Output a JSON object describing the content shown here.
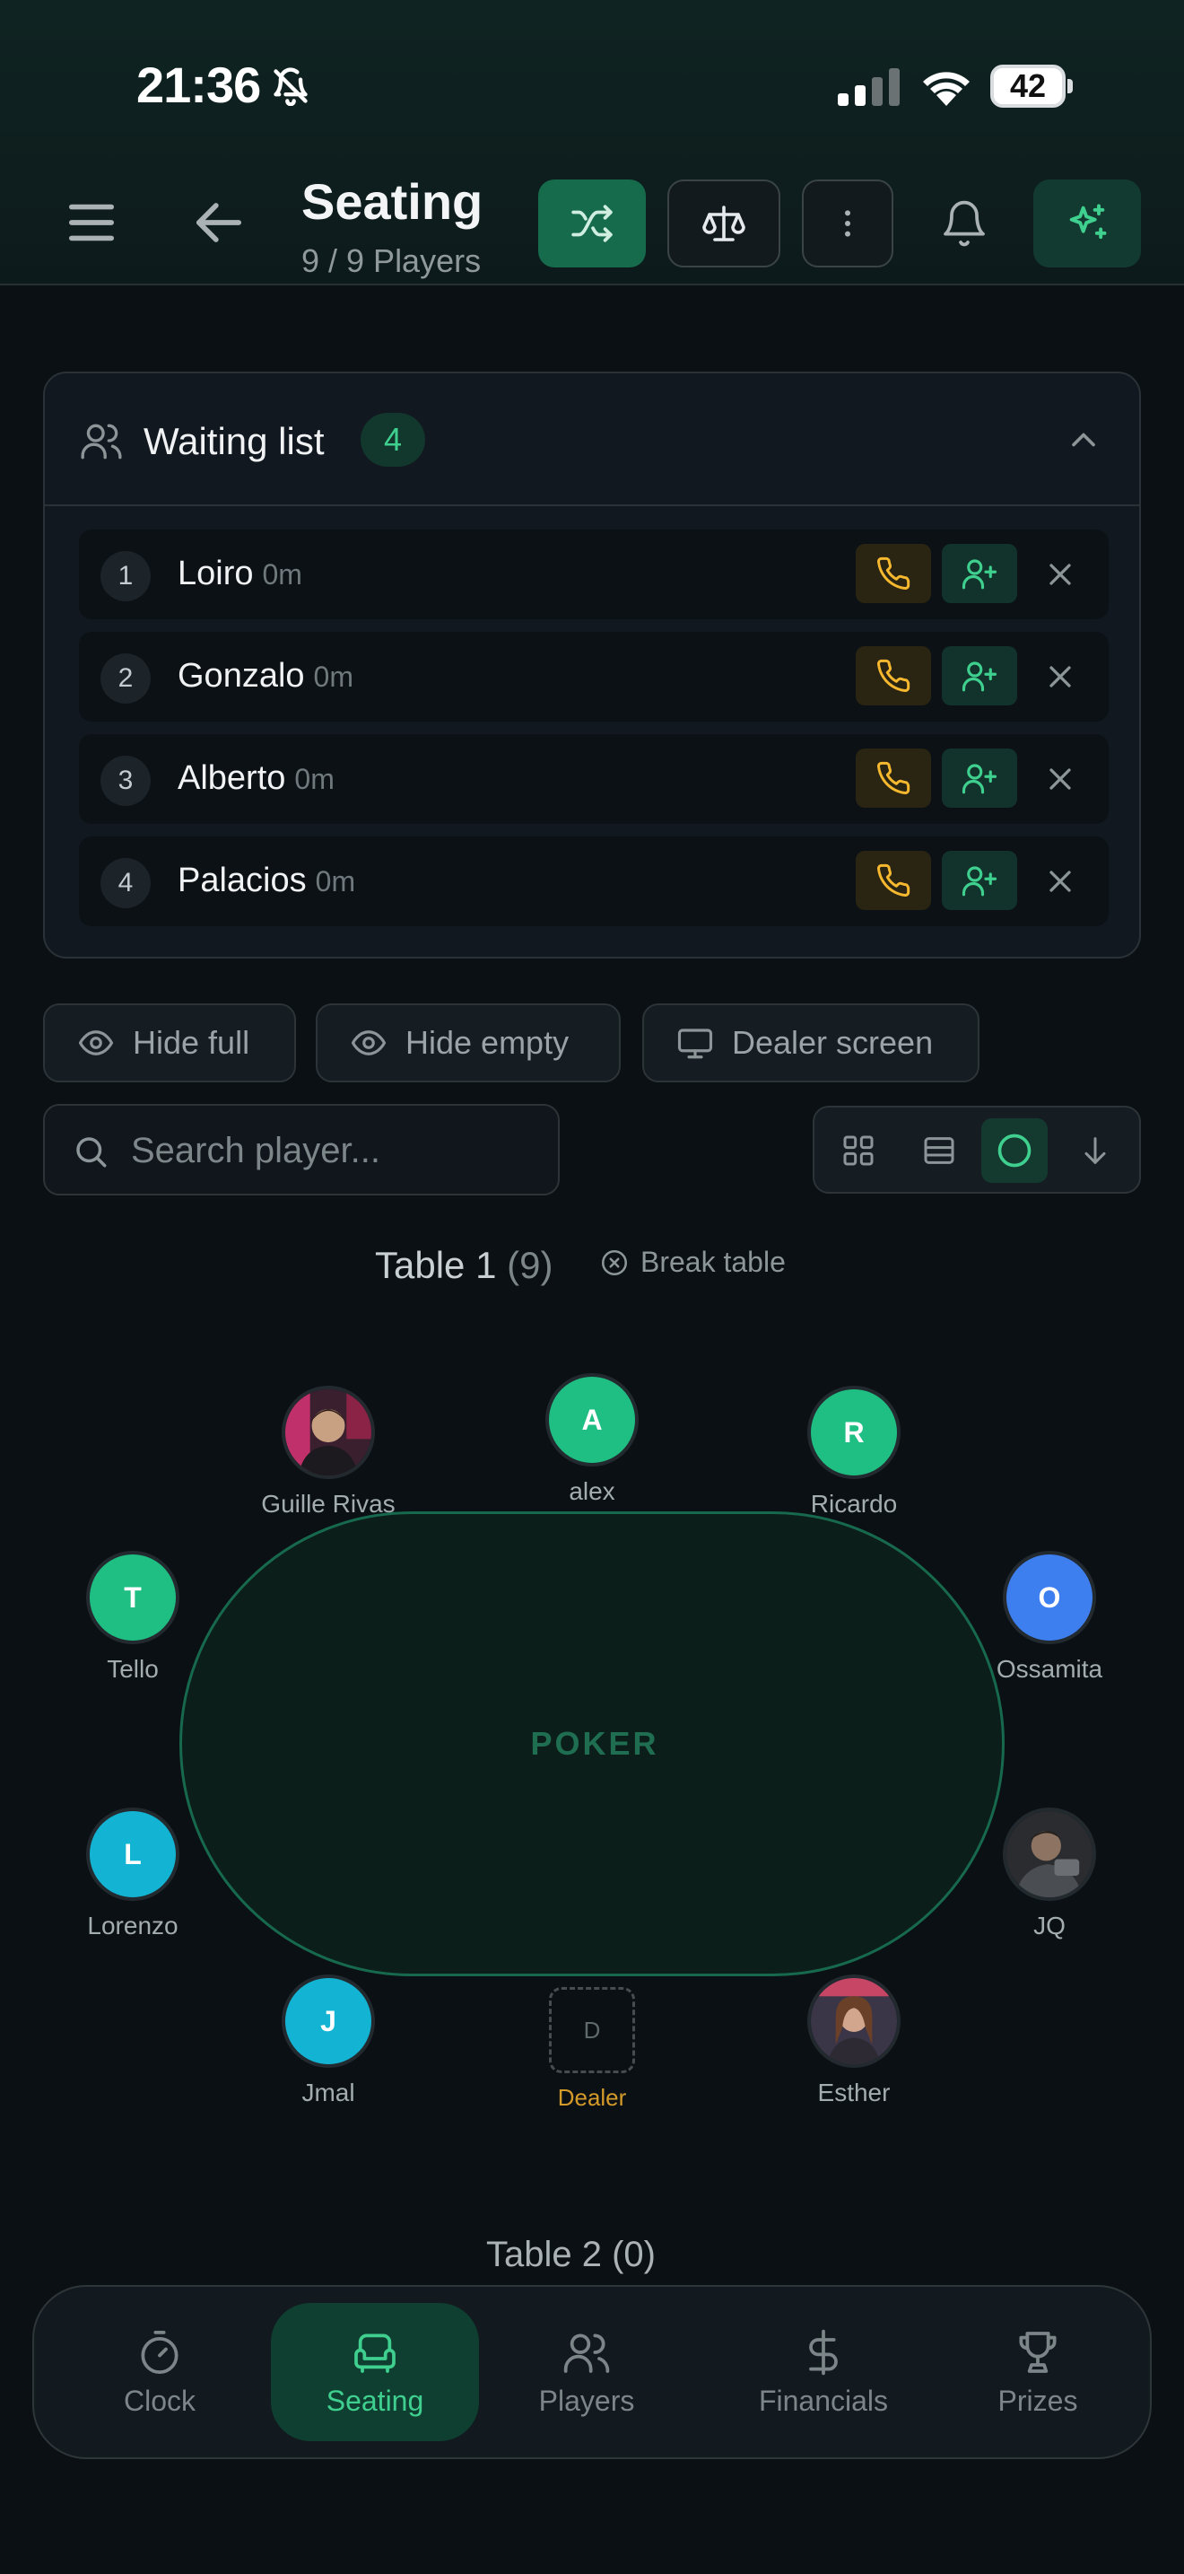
{
  "status_bar": {
    "time": "21:36",
    "battery": "42",
    "battery_level": 0.42
  },
  "header": {
    "title": "Seating",
    "subtitle": "9 / 9 Players"
  },
  "waiting_list": {
    "title": "Waiting list",
    "count": "4",
    "entries": [
      {
        "position": "1",
        "name": "Loiro",
        "wait": "0m"
      },
      {
        "position": "2",
        "name": "Gonzalo",
        "wait": "0m"
      },
      {
        "position": "3",
        "name": "Alberto",
        "wait": "0m"
      },
      {
        "position": "4",
        "name": "Palacios",
        "wait": "0m"
      }
    ]
  },
  "filters": {
    "hide_full": "Hide full",
    "hide_empty": "Hide empty",
    "dealer_screen": "Dealer screen"
  },
  "search": {
    "placeholder": "Search player..."
  },
  "view_modes": {
    "active": "circle",
    "options": [
      "grid",
      "list",
      "circle",
      "sort-down"
    ]
  },
  "table1": {
    "name": "Table 1",
    "count": "(9)",
    "break_label": "Break table",
    "felt_label": "POKER",
    "seats": [
      {
        "name": "Guille Rivas",
        "initial": "",
        "color": "photo"
      },
      {
        "name": "alex",
        "initial": "A",
        "color": "#1fbf84"
      },
      {
        "name": "Ricardo",
        "initial": "R",
        "color": "#1fbf84"
      },
      {
        "name": "Tello",
        "initial": "T",
        "color": "#1fbf84"
      },
      {
        "name": "Ossamita",
        "initial": "O",
        "color": "#3e7ff0"
      },
      {
        "name": "Lorenzo",
        "initial": "L",
        "color": "#13b4d3"
      },
      {
        "name": "JQ",
        "initial": "",
        "color": "photo"
      },
      {
        "name": "Jmal",
        "initial": "J",
        "color": "#13b4d3"
      },
      {
        "name": "Esther",
        "initial": "",
        "color": "photo"
      }
    ],
    "dealer": {
      "initial": "D",
      "label": "Dealer"
    }
  },
  "table2": {
    "name": "Table 2",
    "count": "(0)"
  },
  "nav": {
    "active": "seating",
    "items": [
      {
        "key": "clock",
        "label": "Clock"
      },
      {
        "key": "seating",
        "label": "Seating"
      },
      {
        "key": "players",
        "label": "Players"
      },
      {
        "key": "financials",
        "label": "Financials"
      },
      {
        "key": "prizes",
        "label": "Prizes"
      }
    ]
  },
  "colors": {
    "accent": "#3fd08f",
    "call": "#f5b82e",
    "background": "#0b1014"
  }
}
